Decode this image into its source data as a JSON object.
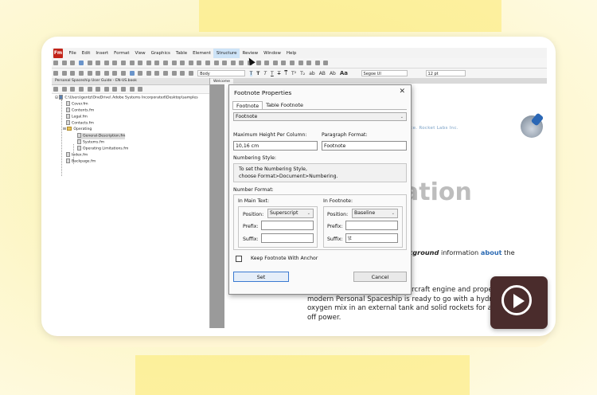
{
  "app": {
    "logo": "Fm",
    "menu": [
      "File",
      "Edit",
      "Insert",
      "Format",
      "View",
      "Graphics",
      "Table",
      "Element",
      "Structure",
      "Review",
      "Window",
      "Help"
    ],
    "active_menu_index": 8,
    "toolbar2": {
      "paragraph_style": "Body",
      "char_glyphs": [
        "T",
        "T",
        "T",
        "T",
        "T",
        "T",
        "T²",
        "T₂",
        "ab",
        "AB",
        "Ab",
        "Aa"
      ],
      "font_name": "Segoe UI",
      "font_size": "12 pt"
    }
  },
  "book_panel": {
    "title": "Personal Spaceship User Guide - EN-US.book",
    "root_path": "C:\\Users\\gentz\\OneDrive\\ Adobe Systems Incorporated\\Desktop\\samples",
    "items": [
      {
        "label": "Cover.fm"
      },
      {
        "label": "Contents.fm"
      },
      {
        "label": "Legal.fm"
      },
      {
        "label": "Contacts.fm"
      },
      {
        "label": "Operating"
      },
      {
        "label": "General-Description.fm"
      },
      {
        "label": "Systems.fm"
      },
      {
        "label": "Operating Limitations.fm"
      },
      {
        "label": "Index.fm"
      },
      {
        "label": "Backpage.fm"
      }
    ]
  },
  "document": {
    "tab": "Welcome",
    "tagline": "Space. Rocket Labs Inc.",
    "heading_fragment": "ation",
    "info_prefix": "",
    "info_bold": "ckground",
    "info_mid": " information ",
    "info_blue": "about",
    "info_suffix": " the",
    "body": "Flight used to depend on an aircraft engine and propeller. Today a modern Personal Spaceship is ready to go with a hydrogen and oxygen mix in an external tank and solid rockets for auxiliary lift-off power."
  },
  "dialog": {
    "title": "Footnote Properties",
    "close": "✕",
    "tabs": [
      "Footnote",
      "Table Footnote"
    ],
    "footnote_type": "Footnote",
    "max_height_label": "Maximum Height Per Column:",
    "max_height_value": "10,16 cm",
    "para_format_label": "Paragraph Format:",
    "para_format_value": "Footnote",
    "numbering_style_label": "Numbering Style:",
    "numbering_line1": "To set the Numbering Style,",
    "numbering_line2": "choose Format>Document>Numbering.",
    "number_format_label": "Number Format:",
    "in_main_text": {
      "label": "In Main Text:",
      "position_label": "Position:",
      "position_value": "Superscript",
      "prefix_label": "Prefix:",
      "prefix_value": "",
      "suffix_label": "Suffix:",
      "suffix_value": ""
    },
    "in_footnote": {
      "label": "In Footnote:",
      "position_label": "Position:",
      "position_value": "Baseline",
      "prefix_label": "Prefix:",
      "prefix_value": "",
      "suffix_label": "Suffix:",
      "suffix_value": "\\t"
    },
    "keep_with_anchor": "Keep Footnote With Anchor",
    "set_button": "Set",
    "cancel_button": "Cancel"
  }
}
